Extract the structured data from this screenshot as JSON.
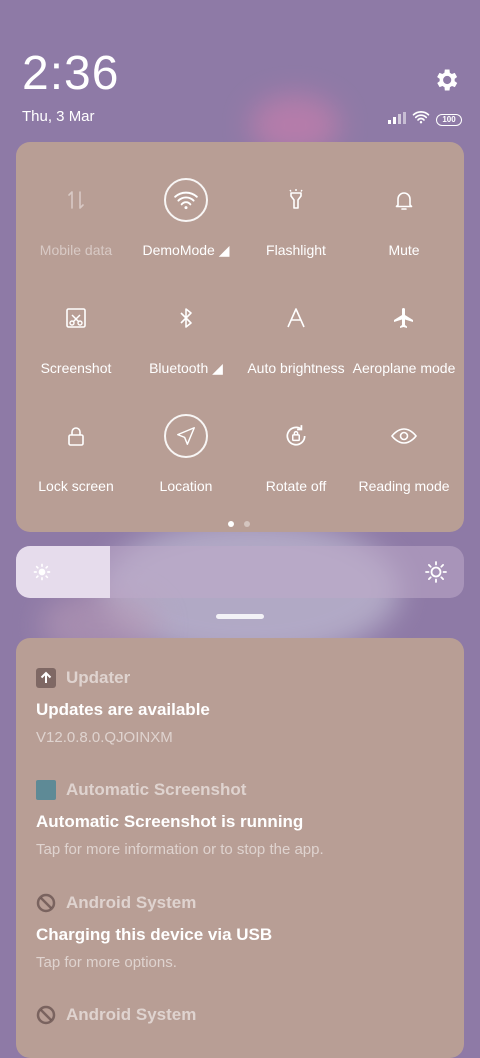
{
  "status": {
    "time": "2:36",
    "date": "Thu, 3 Mar",
    "battery": "100"
  },
  "quick_settings": {
    "tiles": [
      {
        "label": "Mobile data",
        "icon": "mobile-data-icon",
        "enabled": false
      },
      {
        "label": "DemoMode",
        "icon": "wifi-icon",
        "active": true
      },
      {
        "label": "Flashlight",
        "icon": "flashlight-icon"
      },
      {
        "label": "Mute",
        "icon": "bell-icon"
      },
      {
        "label": "Screenshot",
        "icon": "screenshot-icon"
      },
      {
        "label": "Bluetooth",
        "icon": "bluetooth-icon"
      },
      {
        "label": "Auto brightness",
        "icon": "auto-brightness-icon"
      },
      {
        "label": "Aeroplane mode",
        "icon": "aeroplane-icon"
      },
      {
        "label": "Lock screen",
        "icon": "lock-icon"
      },
      {
        "label": "Location",
        "icon": "location-icon",
        "active": true
      },
      {
        "label": "Rotate off",
        "icon": "rotate-lock-icon"
      },
      {
        "label": "Reading mode",
        "icon": "eye-icon"
      }
    ],
    "page_count": 2,
    "current_page": 1
  },
  "brightness": {
    "level": 0.21
  },
  "notifications": [
    {
      "app": "Updater",
      "title": "Updates are available",
      "body": "V12.0.8.0.QJOINXM"
    },
    {
      "app": "Automatic Screenshot",
      "title": "Automatic Screenshot is running",
      "body": "Tap for more information or to stop the app."
    },
    {
      "app": "Android System",
      "title": "Charging this device via USB",
      "body": "Tap for more options."
    },
    {
      "app": "Android System",
      "title": "",
      "body": ""
    }
  ]
}
